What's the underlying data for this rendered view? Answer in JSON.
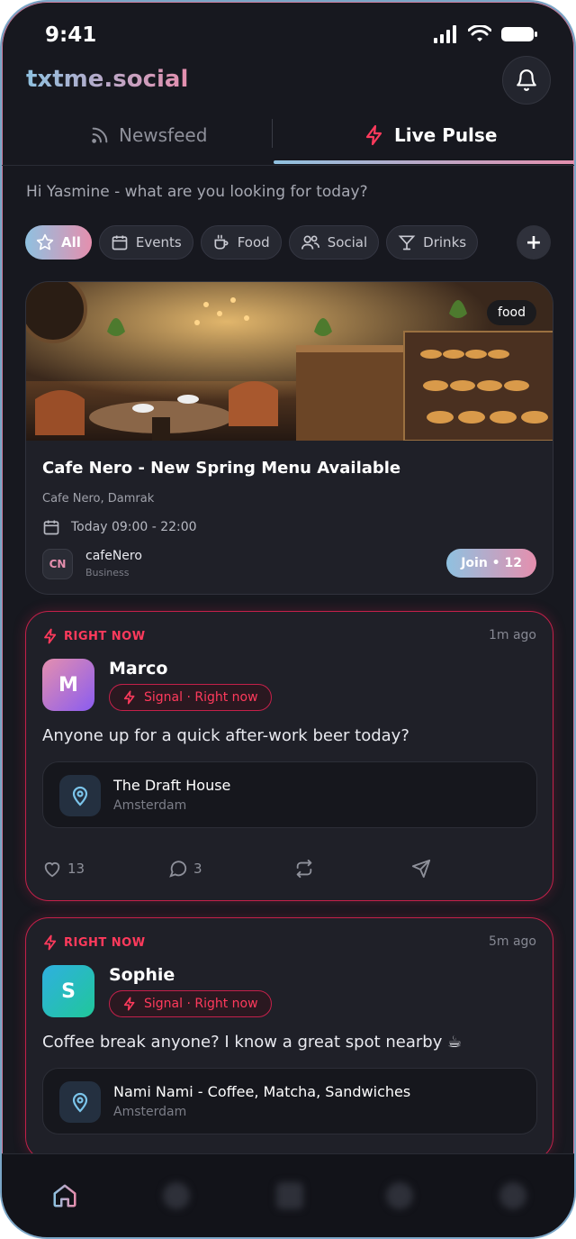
{
  "status_bar": {
    "time": "9:41"
  },
  "app": {
    "logo": "txtme.social"
  },
  "tabs": [
    {
      "label": "Newsfeed",
      "icon": "rss-icon"
    },
    {
      "label": "Live Pulse",
      "icon": "bolt-icon"
    }
  ],
  "greeting": "Hi Yasmine - what are you looking for today?",
  "chips": [
    {
      "label": "All",
      "icon": "star-icon",
      "active": true
    },
    {
      "label": "Events",
      "icon": "calendar-icon"
    },
    {
      "label": "Food",
      "icon": "coffee-cup-icon"
    },
    {
      "label": "Social",
      "icon": "users-icon"
    },
    {
      "label": "Drinks",
      "icon": "cocktail-icon"
    }
  ],
  "add_chip": "+",
  "event": {
    "tag": "food",
    "title": "Cafe Nero - New Spring Menu Available",
    "place": "Cafe Nero, Damrak",
    "date": "Today 09:00 - 22:00",
    "host_initials": "CN",
    "host_name": "cafeNero",
    "host_type": "Business",
    "join_label": "Join • 12"
  },
  "pulses": [
    {
      "badge": "RIGHT NOW",
      "ago": "1m ago",
      "initial": "M",
      "name": "Marco",
      "signal": "Signal · Right now",
      "message": "Anyone up for a quick after-work beer today?",
      "location": "The Draft House",
      "city": "Amsterdam",
      "likes": "13",
      "comments": "3"
    },
    {
      "badge": "RIGHT NOW",
      "ago": "5m ago",
      "initial": "S",
      "name": "Sophie",
      "signal": "Signal · Right now",
      "message": "Coffee break anyone? I know a great spot nearby ☕",
      "location": "Nami Nami - Coffee, Matcha, Sandwiches",
      "city": "Amsterdam"
    }
  ],
  "colors": {
    "accent_start": "#8fc1e0",
    "accent_end": "#e58fae",
    "pulse_red": "#ff3a5c",
    "background": "#17181f"
  }
}
